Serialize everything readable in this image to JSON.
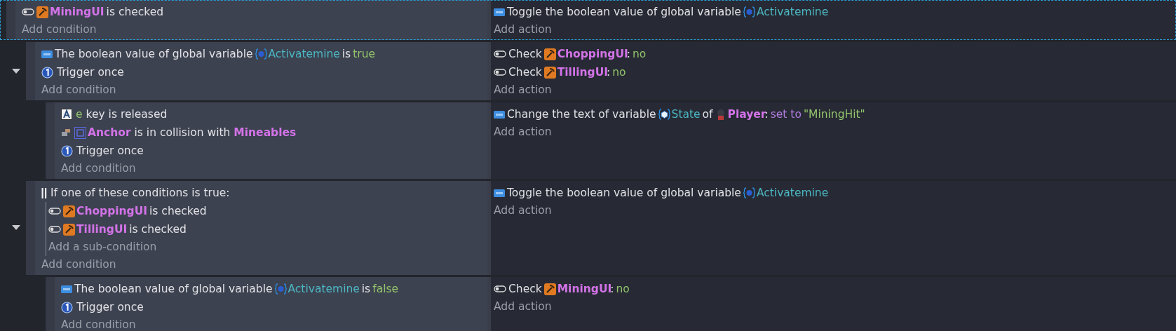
{
  "events": [
    {
      "selected": true,
      "conditions": [
        {
          "kind": "toggle",
          "parts": [
            {
              "kind": "tool",
              "text": "MiningUI"
            },
            {
              "kind": "text",
              "text": "is checked"
            }
          ]
        }
      ],
      "add_condition": "Add condition",
      "actions": [
        {
          "kind": "variable",
          "parts": [
            {
              "kind": "text",
              "text": "Toggle the boolean value of global variable"
            },
            {
              "kind": "variable",
              "text": "Activatemine"
            }
          ]
        }
      ],
      "add_action": "Add action",
      "children": [
        {
          "selected": false,
          "expanded": true,
          "conditions": [
            {
              "kind": "variable",
              "parts": [
                {
                  "kind": "text",
                  "text": "The boolean value of global variable"
                },
                {
                  "kind": "variable",
                  "text": "Activatemine"
                },
                {
                  "kind": "text",
                  "text": "is"
                },
                {
                  "kind": "value",
                  "text": "true"
                }
              ]
            },
            {
              "kind": "trigger",
              "parts": [
                {
                  "kind": "text",
                  "text": "Trigger once"
                }
              ]
            }
          ],
          "add_condition": "Add condition",
          "actions": [
            {
              "kind": "toggle",
              "parts": [
                {
                  "kind": "text",
                  "text": "Check"
                },
                {
                  "kind": "tool",
                  "text": "ChoppingUI"
                },
                {
                  "kind": "punct",
                  "text": ":"
                },
                {
                  "kind": "value",
                  "text": "no"
                }
              ]
            },
            {
              "kind": "toggle",
              "parts": [
                {
                  "kind": "text",
                  "text": "Check"
                },
                {
                  "kind": "tool",
                  "text": "TillingUI"
                },
                {
                  "kind": "punct",
                  "text": ":"
                },
                {
                  "kind": "value",
                  "text": "no"
                }
              ]
            }
          ],
          "add_action": "Add action",
          "children": [
            {
              "selected": false,
              "conditions": [
                {
                  "kind": "key",
                  "parts": [
                    {
                      "kind": "value",
                      "text": "e"
                    },
                    {
                      "kind": "text",
                      "text": "key is released"
                    }
                  ]
                },
                {
                  "kind": "collision",
                  "parts": [
                    {
                      "kind": "box",
                      "text": "Anchor"
                    },
                    {
                      "kind": "text",
                      "text": "is in collision with"
                    },
                    {
                      "kind": "object",
                      "text": "Mineables"
                    }
                  ]
                },
                {
                  "kind": "trigger",
                  "parts": [
                    {
                      "kind": "text",
                      "text": "Trigger once"
                    }
                  ]
                }
              ],
              "add_condition": "Add condition",
              "actions": [
                {
                  "kind": "variable",
                  "parts": [
                    {
                      "kind": "text",
                      "text": "Change the text of variable"
                    },
                    {
                      "kind": "object_variable",
                      "text": "State"
                    },
                    {
                      "kind": "text",
                      "text": "of"
                    },
                    {
                      "kind": "figure",
                      "text": "Player"
                    },
                    {
                      "kind": "punct",
                      "text": ":"
                    },
                    {
                      "kind": "operator",
                      "text": "set to"
                    },
                    {
                      "kind": "value",
                      "text": "\"MiningHit\""
                    }
                  ]
                }
              ],
              "add_action": "Add action"
            }
          ]
        },
        {
          "selected": false,
          "expanded": true,
          "conditions": [
            {
              "kind": "or",
              "parts": [
                {
                  "kind": "text",
                  "text": "If one of these conditions is true:"
                }
              ],
              "sub_conditions": [
                {
                  "kind": "toggle",
                  "parts": [
                    {
                      "kind": "tool",
                      "text": "ChoppingUI"
                    },
                    {
                      "kind": "text",
                      "text": "is checked"
                    }
                  ]
                },
                {
                  "kind": "toggle",
                  "parts": [
                    {
                      "kind": "tool",
                      "text": "TillingUI"
                    },
                    {
                      "kind": "text",
                      "text": "is checked"
                    }
                  ]
                }
              ],
              "add_sub_condition": "Add a sub-condition"
            }
          ],
          "add_condition": "Add condition",
          "actions": [
            {
              "kind": "variable",
              "parts": [
                {
                  "kind": "text",
                  "text": "Toggle the boolean value of global variable"
                },
                {
                  "kind": "variable",
                  "text": "Activatemine"
                }
              ]
            }
          ],
          "add_action": "Add action",
          "children": [
            {
              "selected": false,
              "conditions": [
                {
                  "kind": "variable",
                  "parts": [
                    {
                      "kind": "text",
                      "text": "The boolean value of global variable"
                    },
                    {
                      "kind": "variable",
                      "text": "Activatemine"
                    },
                    {
                      "kind": "text",
                      "text": "is"
                    },
                    {
                      "kind": "value",
                      "text": "false"
                    }
                  ]
                },
                {
                  "kind": "trigger",
                  "parts": [
                    {
                      "kind": "text",
                      "text": "Trigger once"
                    }
                  ]
                }
              ],
              "add_condition": "Add condition",
              "actions": [
                {
                  "kind": "toggle",
                  "parts": [
                    {
                      "kind": "text",
                      "text": "Check"
                    },
                    {
                      "kind": "tool",
                      "text": "MiningUI"
                    },
                    {
                      "kind": "punct",
                      "text": ":"
                    },
                    {
                      "kind": "value",
                      "text": "no"
                    }
                  ]
                }
              ],
              "add_action": "Add action"
            }
          ]
        }
      ]
    }
  ]
}
